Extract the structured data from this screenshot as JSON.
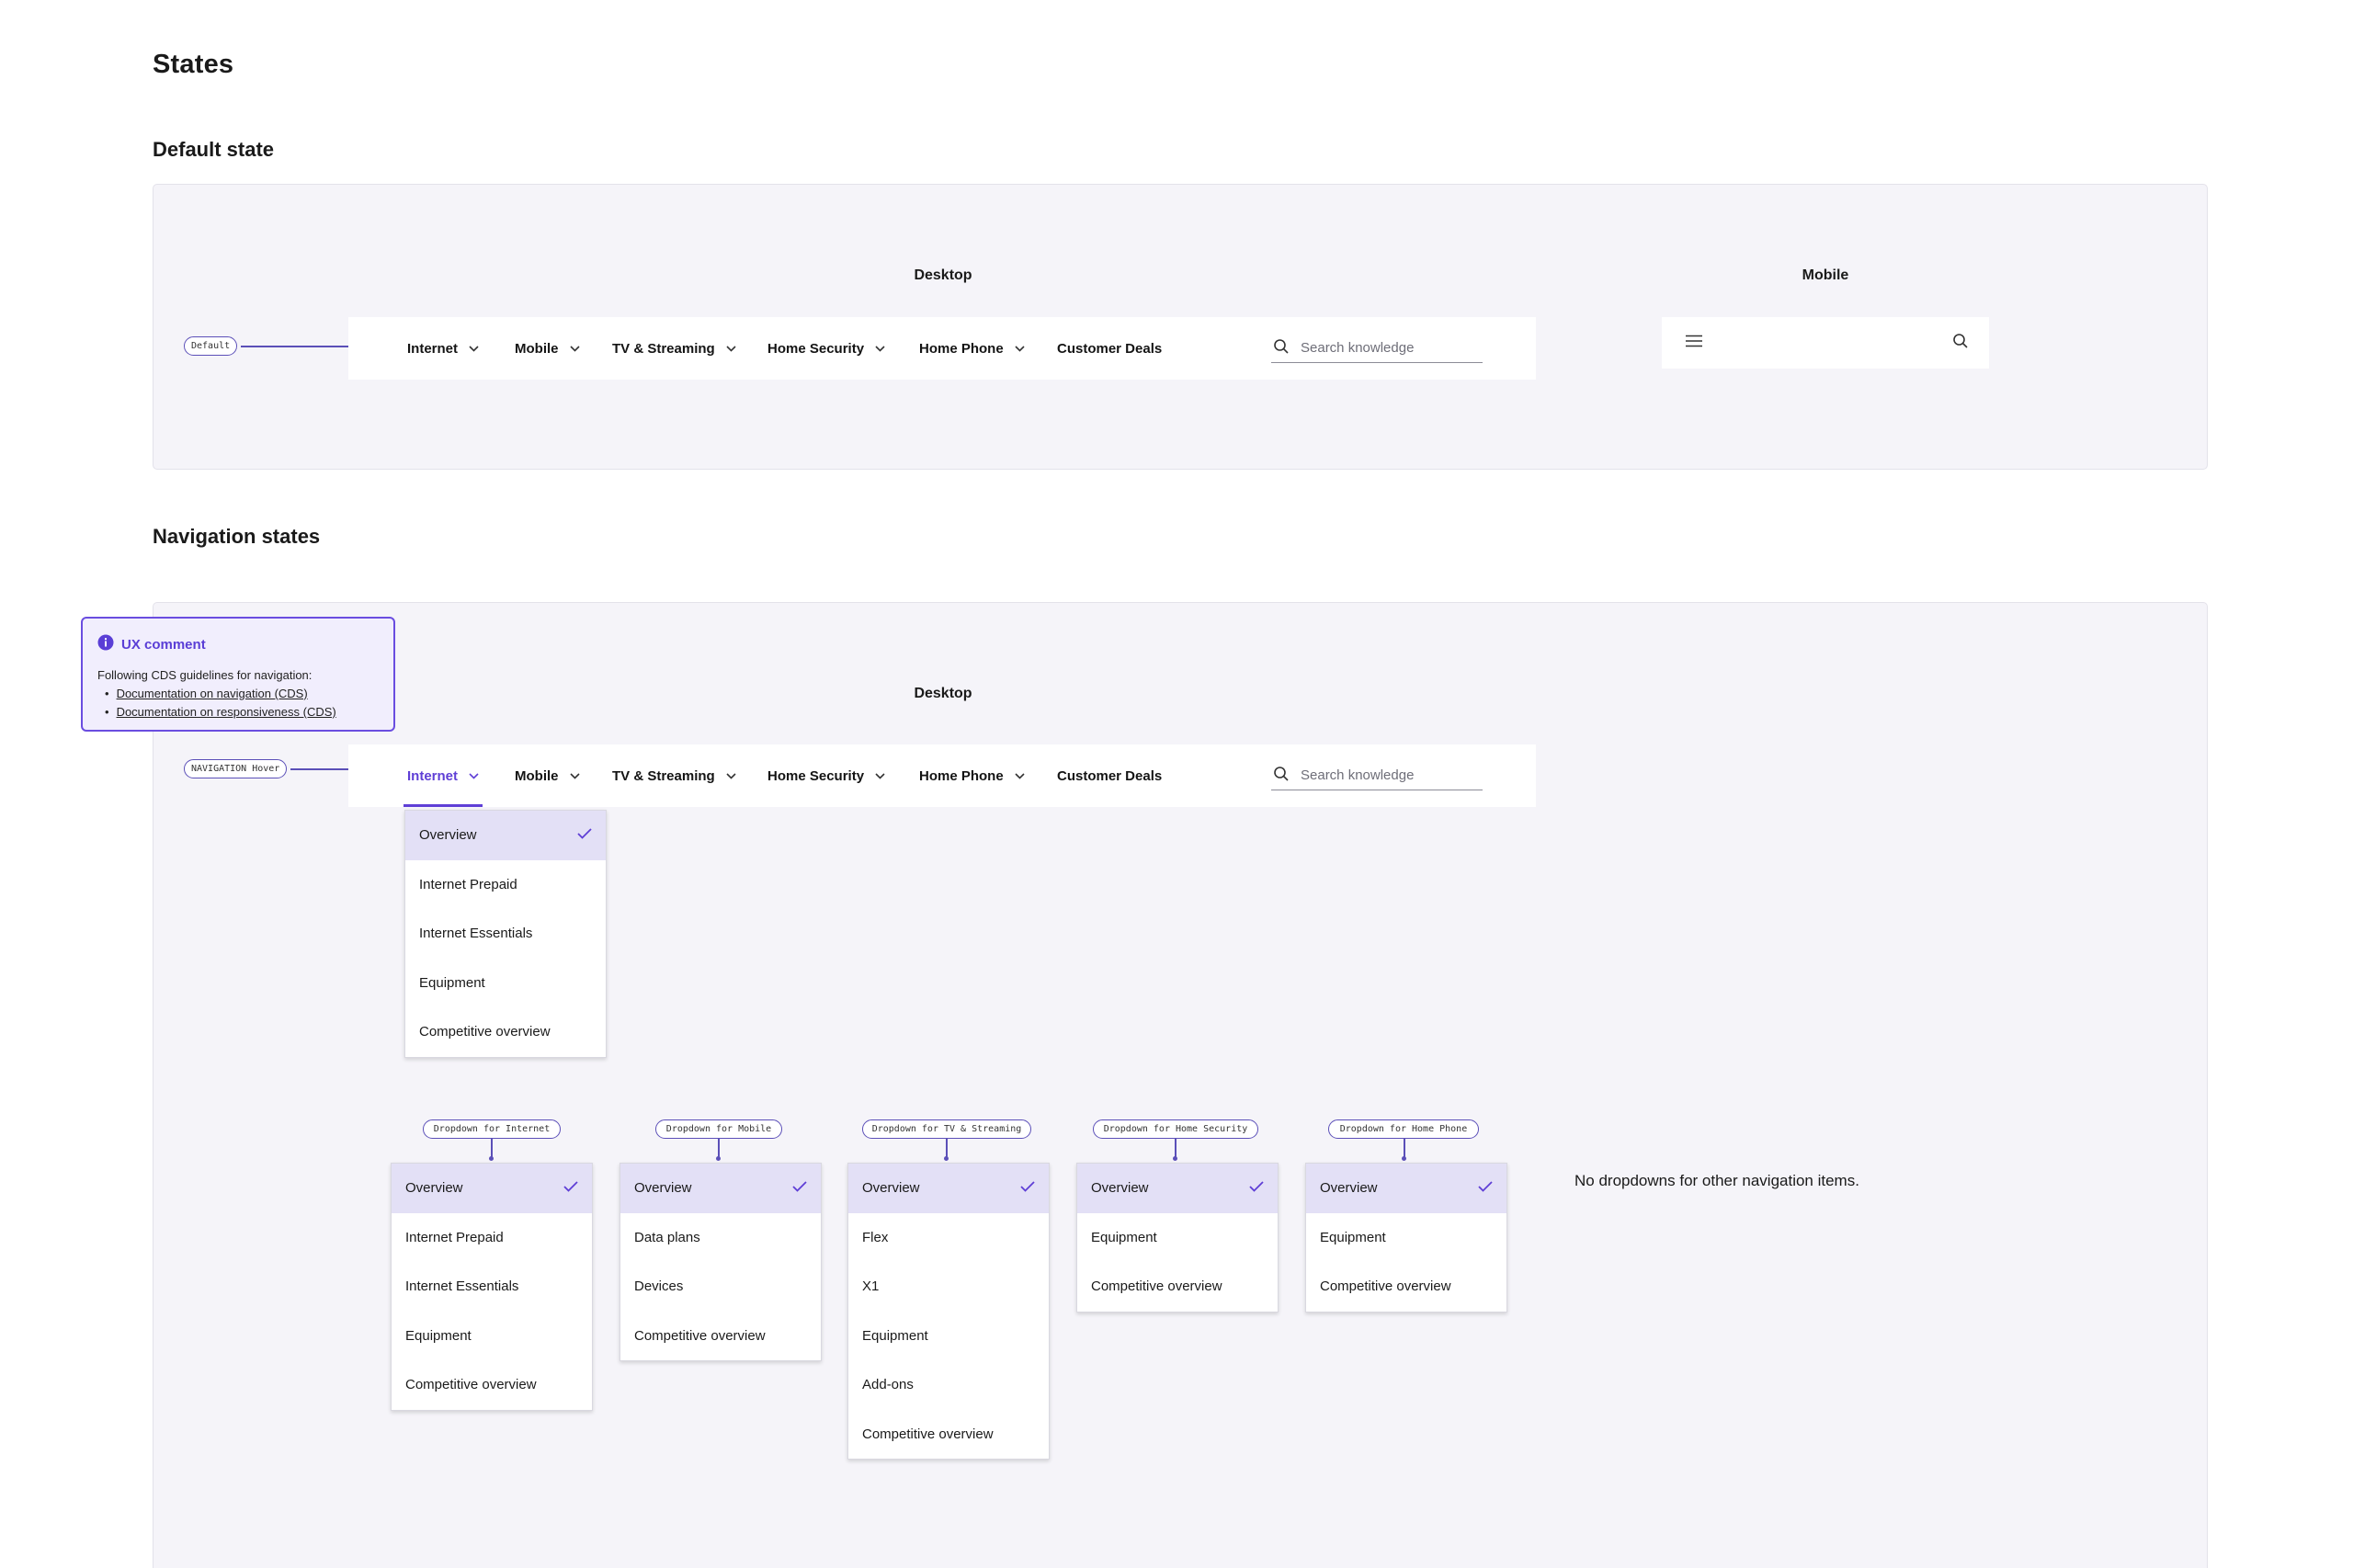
{
  "page": {
    "title": "States",
    "default_section": "Default state",
    "navigation_section": "Navigation states"
  },
  "colors": {
    "accent": "#5f3fd6",
    "panel_bg": "#f5f4f9",
    "selected_bg": "#e3e0f6"
  },
  "default_state": {
    "desktop_caption": "Desktop",
    "mobile_caption": "Mobile",
    "tag": "Default"
  },
  "navigation_states": {
    "desktop_caption": "Desktop",
    "tag": "NAVIGATION Hover"
  },
  "nav": {
    "items": [
      {
        "label": "Internet",
        "has_dropdown": true
      },
      {
        "label": "Mobile",
        "has_dropdown": true
      },
      {
        "label": "TV & Streaming",
        "has_dropdown": true
      },
      {
        "label": "Home Security",
        "has_dropdown": true
      },
      {
        "label": "Home Phone",
        "has_dropdown": true
      },
      {
        "label": "Customer Deals",
        "has_dropdown": false
      }
    ],
    "search_placeholder": "Search knowledge",
    "active_item": "Internet"
  },
  "mobile_nav": {
    "menu_icon": "hamburger-icon",
    "search_icon": "search-icon"
  },
  "ux_comment": {
    "title": "UX comment",
    "text": "Following CDS guidelines for navigation:",
    "links": [
      "Documentation on navigation (CDS)",
      "Documentation on responsiveness (CDS)"
    ]
  },
  "hover_dropdown": {
    "items": [
      "Overview",
      "Internet Prepaid",
      "Internet Essentials",
      "Equipment",
      "Competitive overview"
    ],
    "selected": "Overview"
  },
  "dropdowns": [
    {
      "tag": "Dropdown for Internet",
      "items": [
        "Overview",
        "Internet Prepaid",
        "Internet Essentials",
        "Equipment",
        "Competitive overview"
      ]
    },
    {
      "tag": "Dropdown for Mobile",
      "items": [
        "Overview",
        "Data plans",
        "Devices",
        "Competitive overview"
      ]
    },
    {
      "tag": "Dropdown for TV & Streaming",
      "items": [
        "Overview",
        "Flex",
        "X1",
        "Equipment",
        "Add-ons",
        "Competitive overview"
      ]
    },
    {
      "tag": "Dropdown for Home Security",
      "items": [
        "Overview",
        "Equipment",
        "Competitive overview"
      ]
    },
    {
      "tag": "Dropdown for Home Phone",
      "items": [
        "Overview",
        "Equipment",
        "Competitive overview"
      ]
    }
  ],
  "no_dropdown_note": "No dropdowns for other navigation items."
}
